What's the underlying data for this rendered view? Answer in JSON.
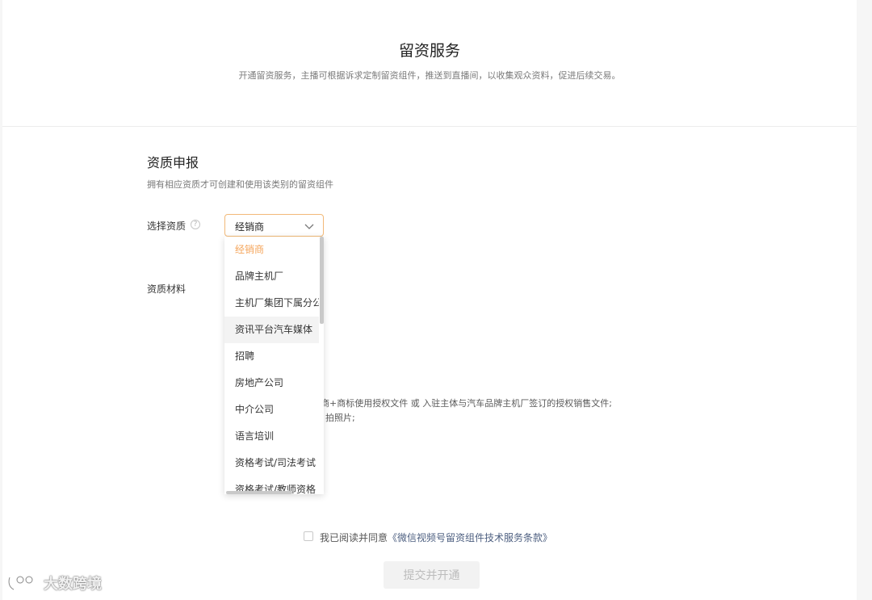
{
  "header": {
    "title": "留资服务",
    "subtitle": "开通留资服务，主播可根据诉求定制留资组件，推送到直播间，以收集观众资料，促进后续交易。"
  },
  "qualification": {
    "title": "资质申报",
    "description": "拥有相应资质才可创建和使用该类别的留资组件",
    "select_label": "选择资质",
    "help_icon": "?",
    "selected_value": "经销商",
    "materials_label": "资质材料",
    "options": [
      "经销商",
      "品牌主机厂",
      "主机厂集团下属分公司",
      "资讯平台汽车媒体",
      "招聘",
      "房地产公司",
      "中介公司",
      "语言培训",
      "资格考试/司法考试",
      "资格考试/教师资格"
    ],
    "hint_line1": "商+商标使用授权文件 或 入驻主体与汽车品牌主机厂签订的授权销售文件;",
    "hint_line2": "拍照片;"
  },
  "agreement": {
    "text": "我已阅读并同意",
    "link": "《微信视频号留资组件技术服务条款》",
    "checked": false
  },
  "submit_label": "提交并开通",
  "watermark": "大数跨境",
  "colors": {
    "accent": "#f5a55b",
    "select_border": "#f2b978",
    "link": "#4d5f80"
  }
}
